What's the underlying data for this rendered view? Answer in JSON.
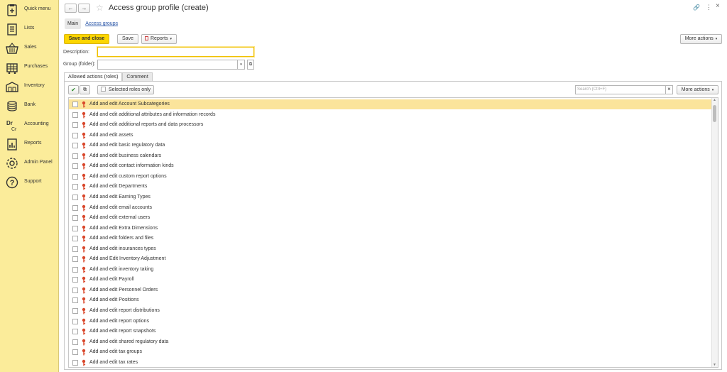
{
  "sidebar": {
    "items": [
      {
        "label": "Quick menu",
        "icon": "clipboard-plus-icon"
      },
      {
        "label": "Lists",
        "icon": "list-document-icon"
      },
      {
        "label": "Sales",
        "icon": "basket-icon"
      },
      {
        "label": "Purchases",
        "icon": "shopping-cart-icon"
      },
      {
        "label": "Inventory",
        "icon": "warehouse-icon"
      },
      {
        "label": "Bank",
        "icon": "coins-icon"
      },
      {
        "label": "Accounting",
        "icon": "debit-credit-icon"
      },
      {
        "label": "Reports",
        "icon": "chart-report-icon"
      },
      {
        "label": "Admin Panel",
        "icon": "gear-icon"
      },
      {
        "label": "Support",
        "icon": "question-circle-icon"
      }
    ]
  },
  "header": {
    "back": "←",
    "forward": "→",
    "title": "Access group profile (create)",
    "link_icon": "🔗",
    "menu_icon": "⋮",
    "close_icon": "×"
  },
  "form_tabs": {
    "main": "Main",
    "access_groups": "Access groups"
  },
  "toolbar": {
    "save_close": "Save and close",
    "save": "Save",
    "reports": "Reports",
    "more_actions": "More actions"
  },
  "fields": {
    "description_label": "Description:",
    "description_value": "",
    "group_label": "Group (folder):",
    "group_value": ""
  },
  "inner_tabs": {
    "allowed": "Allowed actions (roles)",
    "comment": "Comment"
  },
  "grid_toolbar": {
    "selected_only": "Selected roles only",
    "search_placeholder": "Search (Ctrl+F)",
    "more_actions": "More actions"
  },
  "roles": [
    "Add and edit Account Subcategories",
    "Add and edit additional attributes and information records",
    "Add and edit additional reports and data processors",
    "Add and edit assets",
    "Add and edit basic regulatory data",
    "Add and edit business calendars",
    "Add and edit contact information kinds",
    "Add and edit custom report options",
    "Add and edit Departments",
    "Add and edit Earning Types",
    "Add and edit email accounts",
    "Add and edit external users",
    "Add and edit Extra Dimensions",
    "Add and edit folders and files",
    "Add and edit insurances types",
    "Add and Edit Inventory Adjustment",
    "Add and edit inventory taking",
    "Add and edit Payroll",
    "Add and edit Personnel Orders",
    "Add and edit Positions",
    "Add and edit report distributions",
    "Add and edit report options",
    "Add and edit report snapshots",
    "Add and edit shared regulatory data",
    "Add and edit tax groups",
    "Add and edit tax rates"
  ],
  "colors": {
    "sidebar_bg": "#fbec9a",
    "primary_button": "#fcd600",
    "selected_row": "#fbe49b",
    "key_icon": "#d9472b"
  }
}
